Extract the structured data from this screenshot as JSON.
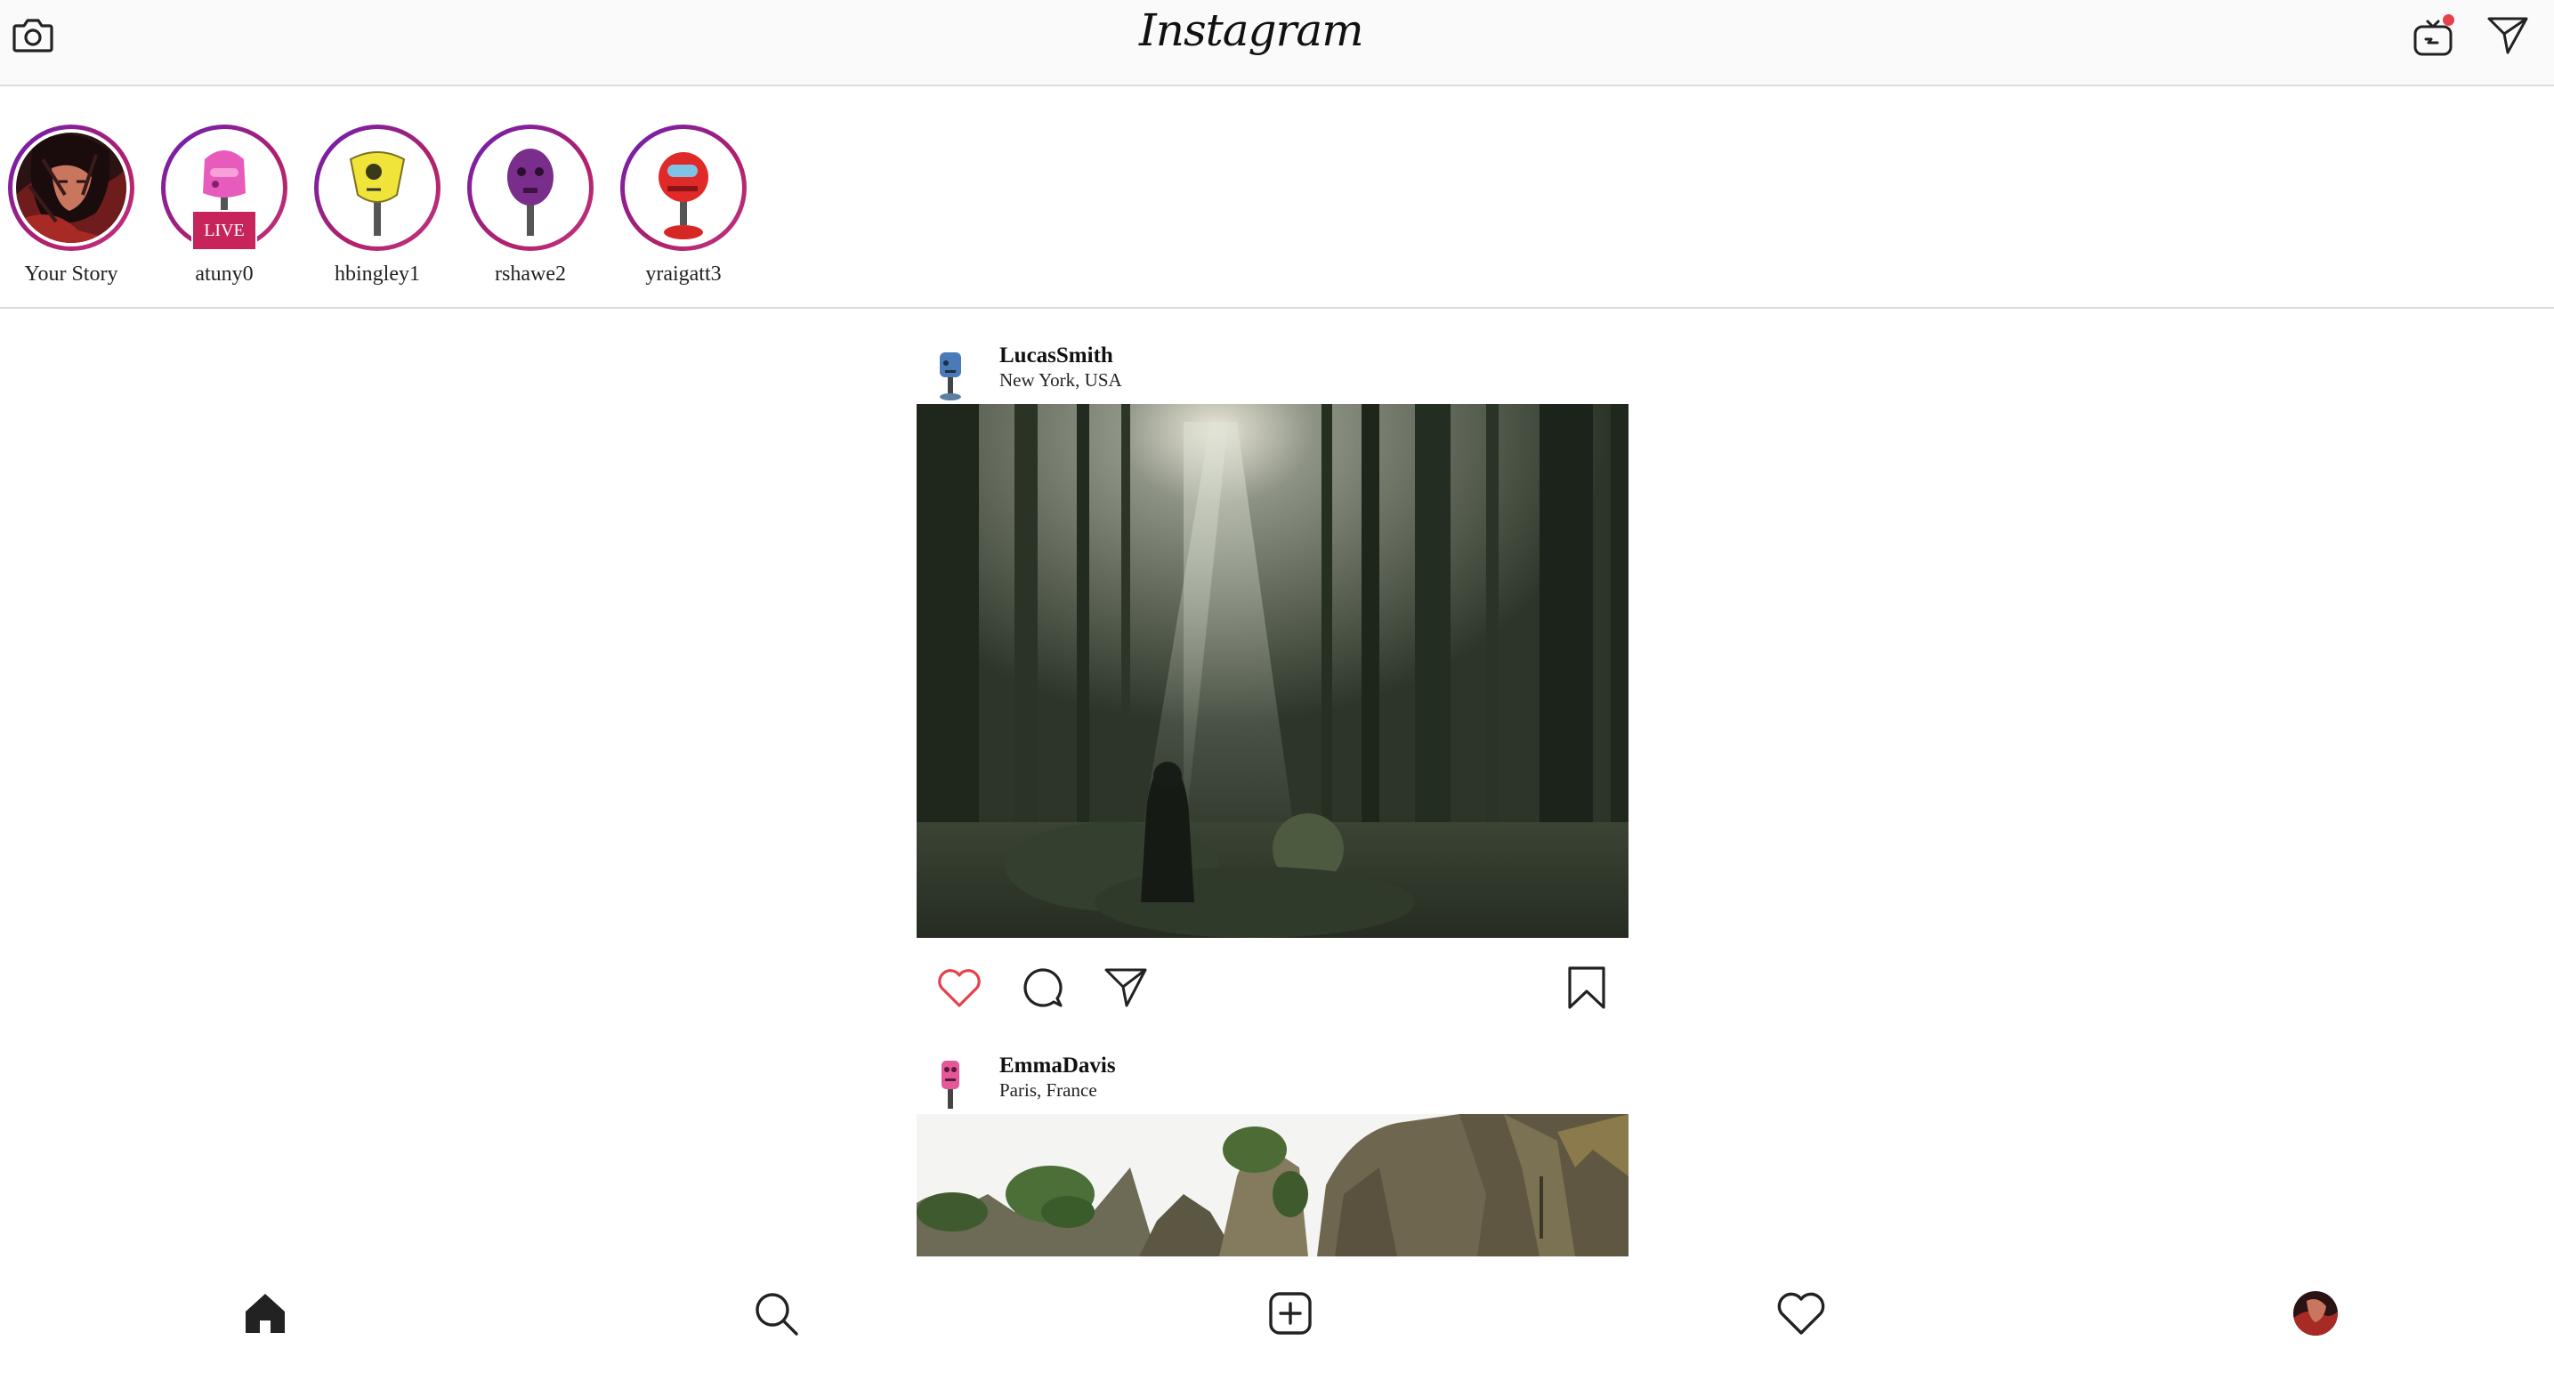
{
  "header": {
    "logo_text": "Instagram",
    "left_icon": "camera-icon",
    "right_icons": [
      "igtv-icon",
      "direct-message-icon"
    ],
    "notification_dot_color": "#e5414d"
  },
  "stories": [
    {
      "name": "Your Story",
      "avatar": "illustrated-portrait",
      "live": false
    },
    {
      "name": "atuny0",
      "avatar": "pink-robot",
      "live": true,
      "live_label": "LIVE"
    },
    {
      "name": "hbingley1",
      "avatar": "yellow-robot",
      "live": false
    },
    {
      "name": "rshawe2",
      "avatar": "purple-robot",
      "live": false
    },
    {
      "name": "yraigatt3",
      "avatar": "red-robot",
      "live": false
    }
  ],
  "posts": [
    {
      "username": "LucasSmith",
      "location": "New York, USA",
      "avatar": "blue-robot",
      "image": "forest-with-sunbeams",
      "liked": true,
      "like_color": "#e5414d"
    },
    {
      "username": "EmmaDavis",
      "location": "Paris, France",
      "avatar": "pink-robot",
      "image": "rock-formations-with-trees"
    }
  ],
  "bottom_nav": [
    "home-icon",
    "search-icon",
    "new-post-icon",
    "activity-heart-icon",
    "profile-avatar"
  ],
  "brand_gradient": [
    "#6a1fb8",
    "#c13584"
  ]
}
